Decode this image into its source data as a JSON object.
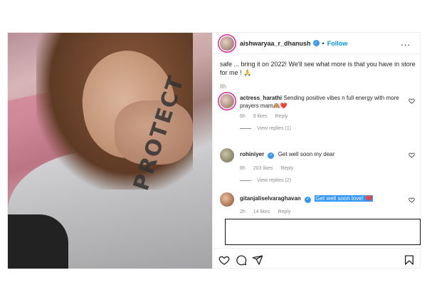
{
  "post": {
    "author": "aishwaryaa_r_dhanush",
    "follow_label": "Follow",
    "dot": "•",
    "more_label": "...",
    "photo_print": "PROTECT"
  },
  "caption": {
    "text": "safe ... bring it on 2022! We'll see what more is that you have in store for me ! 🙏",
    "time": "8h"
  },
  "comments": [
    {
      "user": "actress_harathi",
      "text": "Sending positive vibes n full energy with more prayers mam🙈❤️",
      "time": "6h",
      "likes": "9 likes",
      "reply_label": "Reply",
      "view_replies": "View replies (1)"
    },
    {
      "user": "rohiniyer",
      "text": "Get well soon my dear",
      "time": "8h",
      "likes": "203 likes",
      "reply_label": "Reply",
      "view_replies": "View replies (2)"
    },
    {
      "user": "gitanjaliselvaraghavan",
      "text": "Get well soon love! ❤️",
      "time": "2h",
      "likes": "14 likes",
      "reply_label": "Reply"
    }
  ],
  "icons": {
    "like": "heart-icon",
    "comment": "comment-icon",
    "share": "paper-plane-icon",
    "save": "bookmark-icon",
    "verified": "verified-badge-icon"
  },
  "colors": {
    "follow": "#0095f6",
    "verified": "#3897f0",
    "selection": "#3297fd",
    "heart": "#ed4956"
  }
}
